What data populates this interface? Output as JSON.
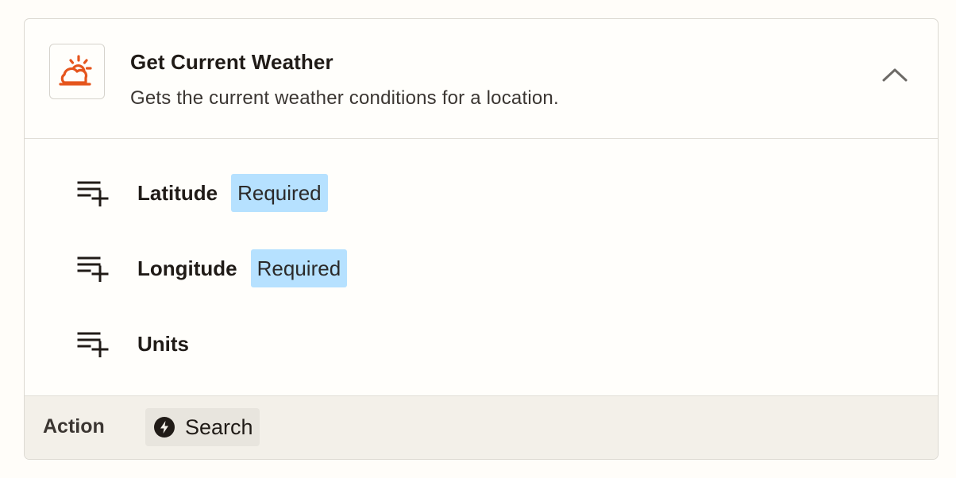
{
  "header": {
    "title": "Get Current Weather",
    "subtitle": "Gets the current weather conditions for a location.",
    "app_icon": "weather-sun-cloud-icon",
    "collapse_icon": "chevron-up-icon"
  },
  "fields": [
    {
      "label": "Latitude",
      "badge": "Required",
      "icon": "list-add-icon"
    },
    {
      "label": "Longitude",
      "badge": "Required",
      "icon": "list-add-icon"
    },
    {
      "label": "Units",
      "badge": "",
      "icon": "list-add-icon"
    }
  ],
  "footer": {
    "label": "Action",
    "chip_label": "Search",
    "chip_icon": "bolt-icon"
  },
  "colors": {
    "accent": "#e5551d",
    "badge_bg": "#b6e1ff",
    "footer_bg": "#f3f0e9"
  }
}
